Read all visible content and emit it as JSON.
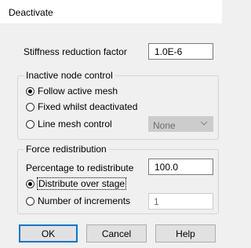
{
  "window": {
    "title": "Deactivate"
  },
  "stiffness": {
    "label": "Stiffness reduction factor",
    "value": "1.0E-6"
  },
  "inactive_node_control": {
    "legend": "Inactive node control",
    "options": [
      {
        "label": "Follow active mesh",
        "checked": true
      },
      {
        "label": "Fixed whilst deactivated",
        "checked": false
      },
      {
        "label": "Line mesh control",
        "checked": false
      }
    ],
    "line_mesh_select": {
      "value": "None",
      "icon": "chevron-down-icon",
      "enabled": false
    }
  },
  "force_redistribution": {
    "legend": "Force redistribution",
    "percentage_label": "Percentage to redistribute",
    "percentage_value": "100.0",
    "options": [
      {
        "label": "Distribute over stage",
        "checked": true
      },
      {
        "label": "Number of increments",
        "checked": false
      }
    ],
    "increments_value": "1"
  },
  "buttons": {
    "ok": "OK",
    "cancel": "Cancel",
    "help": "Help"
  }
}
